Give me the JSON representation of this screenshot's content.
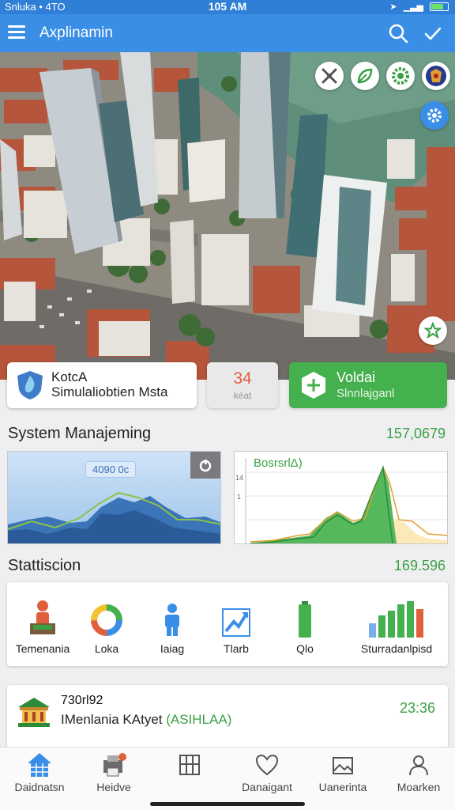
{
  "status_bar": {
    "carrier": "Snluka",
    "network": "4TO",
    "time": "105 AM"
  },
  "app_bar": {
    "title": "Axplinamin"
  },
  "colors": {
    "primary": "#3a8ee6",
    "accent_green": "#45b04e",
    "count_red": "#e0603c"
  },
  "hero": {
    "top_icons": [
      "tools-icon",
      "leaf-icon",
      "gear-badge-icon",
      "emblem-icon"
    ],
    "gear_button": "gear-icon",
    "star_button": "star-icon"
  },
  "cards": {
    "simulation": {
      "title": "KotcA",
      "subtitle": "Simulaliobtien Msta"
    },
    "count": {
      "value": "34",
      "label": "kéat"
    },
    "add": {
      "title": "Voldai",
      "subtitle": "Slnnlajganl"
    }
  },
  "system": {
    "title": "System Manajeming",
    "value": "157,0679",
    "left_chart": {
      "chip": "4090 0c",
      "button": "refresh-icon"
    },
    "right_chart": {
      "title": "BosrsrlΔ)",
      "ytick_top": "14",
      "ytick_mid": "1"
    }
  },
  "statistics": {
    "title": "Stattiscion",
    "value": "169.596",
    "items": [
      {
        "label": "Temenania",
        "icon": "person-podium-icon"
      },
      {
        "label": "Loka",
        "icon": "donut-chart-icon"
      },
      {
        "label": "Iaiag",
        "icon": "person-icon"
      },
      {
        "label": "Tlarb",
        "icon": "trend-chart-icon"
      },
      {
        "label": "Qlo",
        "icon": "battery-icon"
      },
      {
        "label": "Sturradanlpisd",
        "icon": "bar-chart-icon"
      }
    ]
  },
  "info": {
    "number": "730rl92",
    "name": "IMenlania KAtyet",
    "tag": "(ASIHLAA)",
    "time": "23:36"
  },
  "bottom_nav": [
    {
      "label": "Daidnatsn",
      "icon": "home-icon"
    },
    {
      "label": "Heidve",
      "icon": "printer-icon"
    },
    {
      "label": "Danaigant",
      "icon": "heart-icon"
    },
    {
      "label": "Uanerinta",
      "icon": "image-icon"
    },
    {
      "label": "Moarken",
      "icon": "profile-icon"
    }
  ]
}
